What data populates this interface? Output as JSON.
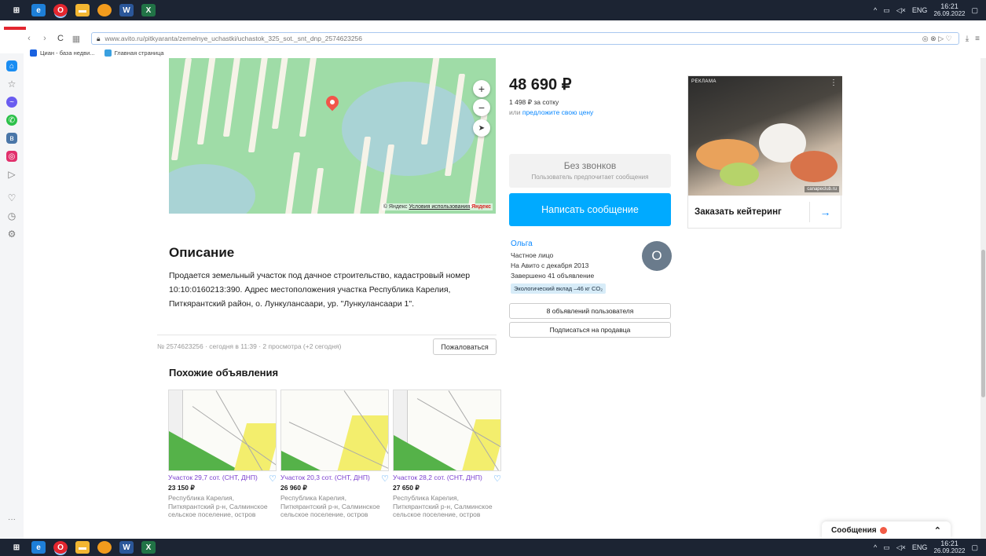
{
  "taskbar": {
    "lang": "ENG",
    "time": "16:21",
    "date": "26.09.2022"
  },
  "browser": {
    "url": "www.avito.ru/pitkyaranta/zemelnye_uchastki/uchastok_325_sot._snt_dnp_2574623256",
    "bookmarks": [
      "Циан - база недви...",
      "Главная страница"
    ]
  },
  "map": {
    "credit_yandex": "© Яндекс",
    "credit_terms": "Условия использования",
    "credit_logo": "Яндекс",
    "zoom_in": "+",
    "zoom_out": "−"
  },
  "listing": {
    "price": "48 690 ₽",
    "per_unit": "1 498 ₽ за сотку",
    "offer_prefix": "или",
    "offer_link": "предложите свою цену",
    "no_calls_title": "Без звонков",
    "no_calls_sub": "Пользователь предпочитает сообщения",
    "write_button": "Написать сообщение",
    "description_heading": "Описание",
    "description": "Продается земельный участок под дачное строительство, кадастровый номер 10:10:0160213:390. Адрес местоположения участка Республика Карелия, Питкярантский район, о. Лункулансаари, ур. \"Лункулансаари 1\".",
    "meta": "№ 2574623256 · сегодня в 11:39 · 2 просмотра (+2 сегодня)",
    "report_button": "Пожаловаться"
  },
  "seller": {
    "name": "Ольга",
    "type": "Частное лицо",
    "since": "На Авито с декабря 2013",
    "completed": "Завершено 41 объявление",
    "eco": "Экологический вклад –46 кг CO₂",
    "avatar_letter": "О",
    "listings_button": "8 объявлений пользователя",
    "subscribe_button": "Подписаться на продавца"
  },
  "ad": {
    "label": "РЕКЛАМА",
    "source": "canapeclub.ru",
    "caption": "Заказать кейтеринг",
    "arrow": "→"
  },
  "similar": {
    "heading": "Похожие объявления",
    "items": [
      {
        "title": "Участок 29,7 сот. (СНТ, ДНП)",
        "price": "23 150 ₽",
        "addr": "Республика Карелия, Питкярантский р-н, Салминское сельское поселение, остров"
      },
      {
        "title": "Участок 20,3 сот. (СНТ, ДНП)",
        "price": "26 960 ₽",
        "addr": "Республика Карелия, Питкярантский р-н, Салминское сельское поселение, остров"
      },
      {
        "title": "Участок 28,2 сот. (СНТ, ДНП)",
        "price": "27 650 ₽",
        "addr": "Республика Карелия, Питкярантский р-н, Салминское сельское поселение, остров"
      }
    ]
  },
  "messages": {
    "label": "Сообщения"
  }
}
